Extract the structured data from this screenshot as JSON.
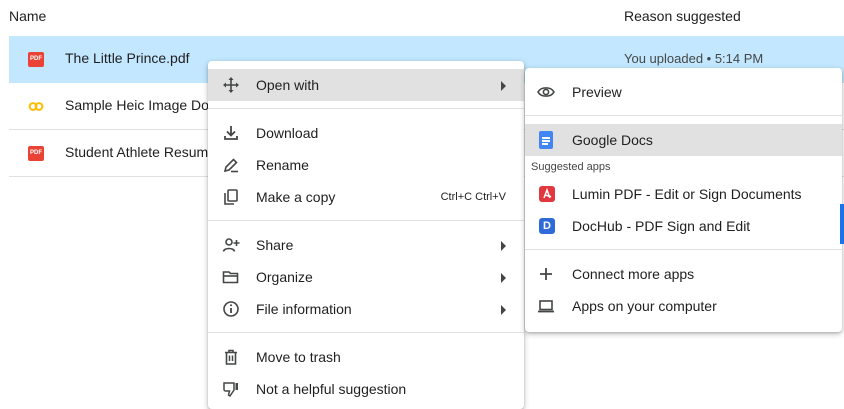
{
  "header": {
    "name_col": "Name",
    "reason_col": "Reason suggested"
  },
  "files": [
    {
      "name": "The Little Prince.pdf",
      "icon": "pdf-icon",
      "reason": "You uploaded • 5:14 PM",
      "selected": true
    },
    {
      "name": "Sample Heic Image Do",
      "icon": "heic-icon",
      "reason": "",
      "selected": false
    },
    {
      "name": "Student Athlete Resum",
      "icon": "pdf-icon",
      "reason": "",
      "selected": false
    }
  ],
  "context_menu": {
    "open_with": "Open with",
    "download": "Download",
    "rename": "Rename",
    "make_copy": "Make a copy",
    "make_copy_shortcut": "Ctrl+C Ctrl+V",
    "share": "Share",
    "organize": "Organize",
    "file_information": "File information",
    "move_to_trash": "Move to trash",
    "not_helpful": "Not a helpful suggestion"
  },
  "open_with_menu": {
    "preview": "Preview",
    "google_docs": "Google Docs",
    "suggested_apps_label": "Suggested apps",
    "lumin": "Lumin PDF - Edit or Sign Documents",
    "dochub": "DocHub - PDF Sign and Edit",
    "connect_more": "Connect more apps",
    "apps_on_computer": "Apps on your computer"
  },
  "icon_glyphs": {
    "pdf_badge": "PDF",
    "dochub_letter": "D"
  },
  "colors": {
    "selected_row": "#c2e7ff",
    "menu_hover": "#e1e1e1",
    "pdf_red": "#ea4335",
    "heic_yellow": "#fbbc04",
    "gdocs_blue": "#4285f4",
    "lumin_red": "#e0383e",
    "dochub_blue": "#2f6bd8"
  }
}
